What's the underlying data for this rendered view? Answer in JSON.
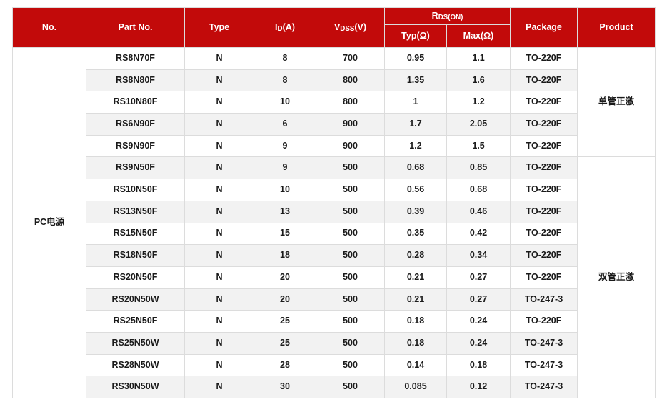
{
  "table": {
    "header": {
      "no": "No.",
      "part_no": "Part No.",
      "type": "Type",
      "id_main": "I",
      "id_sub": "D",
      "id_tail": "(A)",
      "vdss_main": "V",
      "vdss_sub": "DSS",
      "vdss_tail": "(V)",
      "rdson_main": "R",
      "rdson_sub": "DS(ON)",
      "typ": "Typ(Ω)",
      "max": "Max(Ω)",
      "package": "Package",
      "product": "Product"
    },
    "group_label_no": "PC电源",
    "product_groups": [
      {
        "label": "单管正激",
        "rowspan": 5
      },
      {
        "label": "双管正激",
        "rowspan": 11
      }
    ],
    "rows": [
      {
        "part_no": "RS8N70F",
        "type": "N",
        "id": "8",
        "vdss": "700",
        "typ": "0.95",
        "max": "1.1",
        "package": "TO-220F"
      },
      {
        "part_no": "RS8N80F",
        "type": "N",
        "id": "8",
        "vdss": "800",
        "typ": "1.35",
        "max": "1.6",
        "package": "TO-220F"
      },
      {
        "part_no": "RS10N80F",
        "type": "N",
        "id": "10",
        "vdss": "800",
        "typ": "1",
        "max": "1.2",
        "package": "TO-220F"
      },
      {
        "part_no": "RS6N90F",
        "type": "N",
        "id": "6",
        "vdss": "900",
        "typ": "1.7",
        "max": "2.05",
        "package": "TO-220F"
      },
      {
        "part_no": "RS9N90F",
        "type": "N",
        "id": "9",
        "vdss": "900",
        "typ": "1.2",
        "max": "1.5",
        "package": "TO-220F"
      },
      {
        "part_no": "RS9N50F",
        "type": "N",
        "id": "9",
        "vdss": "500",
        "typ": "0.68",
        "max": "0.85",
        "package": "TO-220F"
      },
      {
        "part_no": "RS10N50F",
        "type": "N",
        "id": "10",
        "vdss": "500",
        "typ": "0.56",
        "max": "0.68",
        "package": "TO-220F"
      },
      {
        "part_no": "RS13N50F",
        "type": "N",
        "id": "13",
        "vdss": "500",
        "typ": "0.39",
        "max": "0.46",
        "package": "TO-220F"
      },
      {
        "part_no": "RS15N50F",
        "type": "N",
        "id": "15",
        "vdss": "500",
        "typ": "0.35",
        "max": "0.42",
        "package": "TO-220F"
      },
      {
        "part_no": "RS18N50F",
        "type": "N",
        "id": "18",
        "vdss": "500",
        "typ": "0.28",
        "max": "0.34",
        "package": "TO-220F"
      },
      {
        "part_no": "RS20N50F",
        "type": "N",
        "id": "20",
        "vdss": "500",
        "typ": "0.21",
        "max": "0.27",
        "package": "TO-220F"
      },
      {
        "part_no": "RS20N50W",
        "type": "N",
        "id": "20",
        "vdss": "500",
        "typ": "0.21",
        "max": "0.27",
        "package": "TO-247-3"
      },
      {
        "part_no": "RS25N50F",
        "type": "N",
        "id": "25",
        "vdss": "500",
        "typ": "0.18",
        "max": "0.24",
        "package": "TO-220F"
      },
      {
        "part_no": "RS25N50W",
        "type": "N",
        "id": "25",
        "vdss": "500",
        "typ": "0.18",
        "max": "0.24",
        "package": "TO-247-3"
      },
      {
        "part_no": "RS28N50W",
        "type": "N",
        "id": "28",
        "vdss": "500",
        "typ": "0.14",
        "max": "0.18",
        "package": "TO-247-3"
      },
      {
        "part_no": "RS30N50W",
        "type": "N",
        "id": "30",
        "vdss": "500",
        "typ": "0.085",
        "max": "0.12",
        "package": "TO-247-3"
      }
    ]
  },
  "colors": {
    "header_red": "#C20A0A",
    "row_alt_gray": "#f2f2f2",
    "row_base_white": "#ffffff",
    "border_gray": "#dcdcdc"
  }
}
